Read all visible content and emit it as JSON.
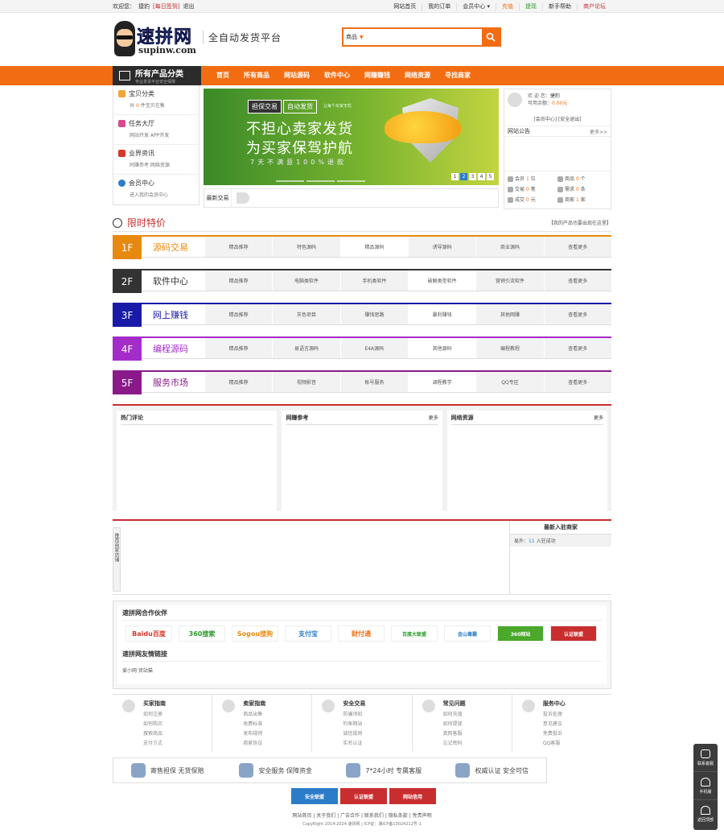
{
  "topbar": {
    "welcome": "欢迎您：",
    "user": "捷豹",
    "signin": "[每日签到]",
    "logout": "退出",
    "links": [
      "网站首页",
      "我的订单",
      "会员中心",
      "充值",
      "提现",
      "新手帮助",
      "商户论坛"
    ]
  },
  "header": {
    "logo_zh": "速拼网",
    "logo_en": "supinw.com",
    "slogan": "全自动发货平台",
    "search_select": "商品",
    "search_placeholder": ""
  },
  "nav": {
    "cat_title": "所有产品分类",
    "cat_sub": "专业发货平台安全保障",
    "items": [
      "首页",
      "所有商品",
      "网站源码",
      "软件中心",
      "网赚赚钱",
      "网络资源",
      "寻找商家"
    ]
  },
  "left": [
    {
      "title": "宝贝分类",
      "sub": "共",
      "count": "0",
      "sub2": "件宝贝在售",
      "color": "#f2a33c"
    },
    {
      "title": "任务大厅",
      "sub": "网站开发  APP开发",
      "color": "#d94a8c"
    },
    {
      "title": "业界资讯",
      "sub": "同赚参考 网络资源",
      "color": "#d9352a"
    },
    {
      "title": "会员中心",
      "sub": "进入我的会员中心",
      "color": "#2b7cc9"
    }
  ],
  "banner": {
    "tag1": "担保交易",
    "tag2": "自动发货",
    "tag3": "让每个买家无忧",
    "line1": "不担心卖家发货",
    "line2": "为买家保驾护航",
    "line3": "7天不满意100%退款",
    "dots": [
      "1",
      "2",
      "3",
      "4",
      "5"
    ]
  },
  "ticker": {
    "label": "最新交易"
  },
  "userpanel": {
    "welcome": "欢 迎 您：",
    "name": "捷豹",
    "balance_label": "可用余额：",
    "balance": "0.00元",
    "links": "[会员中心]  [安全退出]",
    "notice": "网站公告",
    "more": "更多>>",
    "stats": [
      {
        "l": "会员",
        "v": "1",
        "u": "位"
      },
      {
        "l": "商品",
        "v": "0",
        "u": "个"
      },
      {
        "l": "交易",
        "v": "0",
        "u": "笔"
      },
      {
        "l": "需求",
        "v": "0",
        "u": "条"
      },
      {
        "l": "成交",
        "v": "0",
        "u": "元"
      },
      {
        "l": "商家",
        "v": "1",
        "u": "家"
      }
    ]
  },
  "flash": {
    "title": "限时特价",
    "right": "【我的产品也要出现在这里】"
  },
  "floors": [
    {
      "num": "1F",
      "name": "源码交易",
      "color": "#e8890f",
      "tabs": [
        "精品推荐",
        "特色源码",
        "精品源码",
        "诱导源码",
        "商业源码",
        "查看更多"
      ],
      "active": 2
    },
    {
      "num": "2F",
      "name": "软件中心",
      "color": "#333333",
      "tabs": [
        "精品推荐",
        "电脑类软件",
        "手机类软件",
        "破解类型软件",
        "营销引流软件",
        "查看更多"
      ],
      "active": 3
    },
    {
      "num": "3F",
      "name": "网上赚钱",
      "color": "#1a1aa8",
      "tabs": [
        "精品推荐",
        "灰色项目",
        "赚钱思路",
        "暴利赚钱",
        "其他网赚",
        "查看更多"
      ],
      "active": 3
    },
    {
      "num": "4F",
      "name": "编程源码",
      "color": "#a42cc9",
      "tabs": [
        "精品推荐",
        "易语言源码",
        "E4A源码",
        "其他源码",
        "编程教程",
        "查看更多"
      ],
      "active": 3
    },
    {
      "num": "5F",
      "name": "服务市场",
      "color": "#8a1a8a",
      "tabs": [
        "精品推荐",
        "视频影音",
        "账号服务",
        "调程教学",
        "QQ专区",
        "查看更多"
      ],
      "active": 3
    }
  ],
  "boxes": [
    {
      "title": "热门评论",
      "more": ""
    },
    {
      "title": "网赚参考",
      "more": "更多"
    },
    {
      "title": "网络资源",
      "more": "更多"
    }
  ],
  "rec": {
    "side": "推荐商家店铺",
    "title": "最新入驻商家",
    "row_prefix": "易外：",
    "row_val": "11",
    "row_suffix": "入驻成功"
  },
  "partner": {
    "title": "速拼网合作伙伴",
    "logos": [
      "Baidu百度",
      "360搜索",
      "Sogou搜狗",
      "支付宝",
      "财付通",
      "百度大联盟",
      "金山毒霸",
      "360网站",
      "认证联盟"
    ],
    "links_title": "速拼网友情链接",
    "links": "爱小网  贸站猫"
  },
  "help": [
    {
      "t": "买家指南",
      "li": [
        "如何注册",
        "如何购买",
        "搜索商品",
        "支付方式"
      ]
    },
    {
      "t": "卖家指南",
      "li": [
        "商品出售",
        "收费标准",
        "发布规则",
        "商家协议"
      ]
    },
    {
      "t": "安全交易",
      "li": [
        "防骗须知",
        "钓鱼网站",
        "诚信规则",
        "实名认证"
      ]
    },
    {
      "t": "常见问题",
      "li": [
        "如何充值",
        "如何提现",
        "真假客服",
        "忘记密码"
      ]
    },
    {
      "t": "服务中心",
      "li": [
        "投诉处理",
        "意见建议",
        "免费投诉",
        "QQ客服"
      ]
    }
  ],
  "guar": [
    "寄售担保  无货保赔",
    "安全服务  保障资金",
    "7*24小时  专属客服",
    "权威认证  安全可信"
  ],
  "cert": [
    "安全联盟",
    "认证联盟",
    "网站信用"
  ],
  "footnav": "网站首页 | 关于我们 | 广告合作 | 联系我们 | 隐私条款 | 免责声明",
  "copyright": "CopyRight 2014-2024 速拼网  |  ICP证：湘ICP备13024212号-1",
  "float": [
    "联系客服",
    "手机版",
    "返回顶部"
  ]
}
